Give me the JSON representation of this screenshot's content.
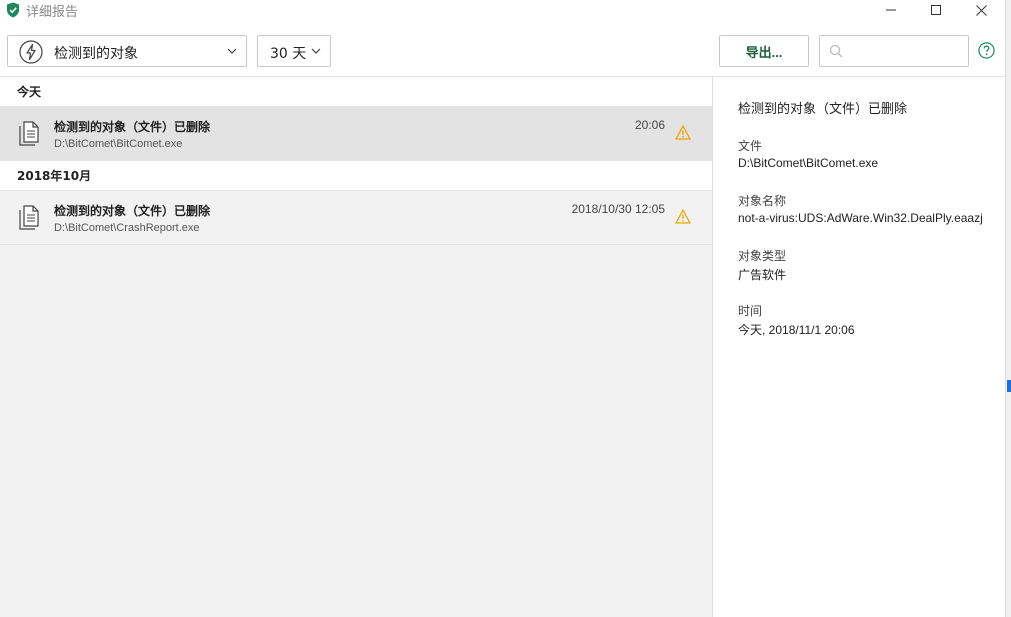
{
  "window": {
    "title": "详细报告"
  },
  "toolbar": {
    "type_filter": "检测到的对象",
    "days_filter": "30 天",
    "export_label": "导出...",
    "search_placeholder": ""
  },
  "groups": [
    {
      "header": "今天",
      "items": [
        {
          "title": "检测到的对象（文件）已删除",
          "path": "D:\\BitComet\\BitComet.exe",
          "time": "20:06",
          "selected": true
        }
      ]
    },
    {
      "header": "2018年10月",
      "items": [
        {
          "title": "检测到的对象（文件）已删除",
          "path": "D:\\BitComet\\CrashReport.exe",
          "time": "2018/10/30 12:05",
          "selected": false
        }
      ]
    }
  ],
  "details": {
    "title": "检测到的对象（文件）已删除",
    "fields": [
      {
        "label": "文件",
        "value": "D:\\BitComet\\BitComet.exe"
      },
      {
        "label": "对象名称",
        "value": "not-a-virus:UDS:AdWare.Win32.DealPly.eaazj"
      },
      {
        "label": "对象类型",
        "value": "广告软件"
      },
      {
        "label": "时间",
        "value": "今天, 2018/11/1 20:06"
      }
    ]
  },
  "colors": {
    "brand_green": "#1a5e3a",
    "warning": "#f0a500",
    "selected_row": "#e3e3e3",
    "list_bg": "#f2f2f2"
  }
}
